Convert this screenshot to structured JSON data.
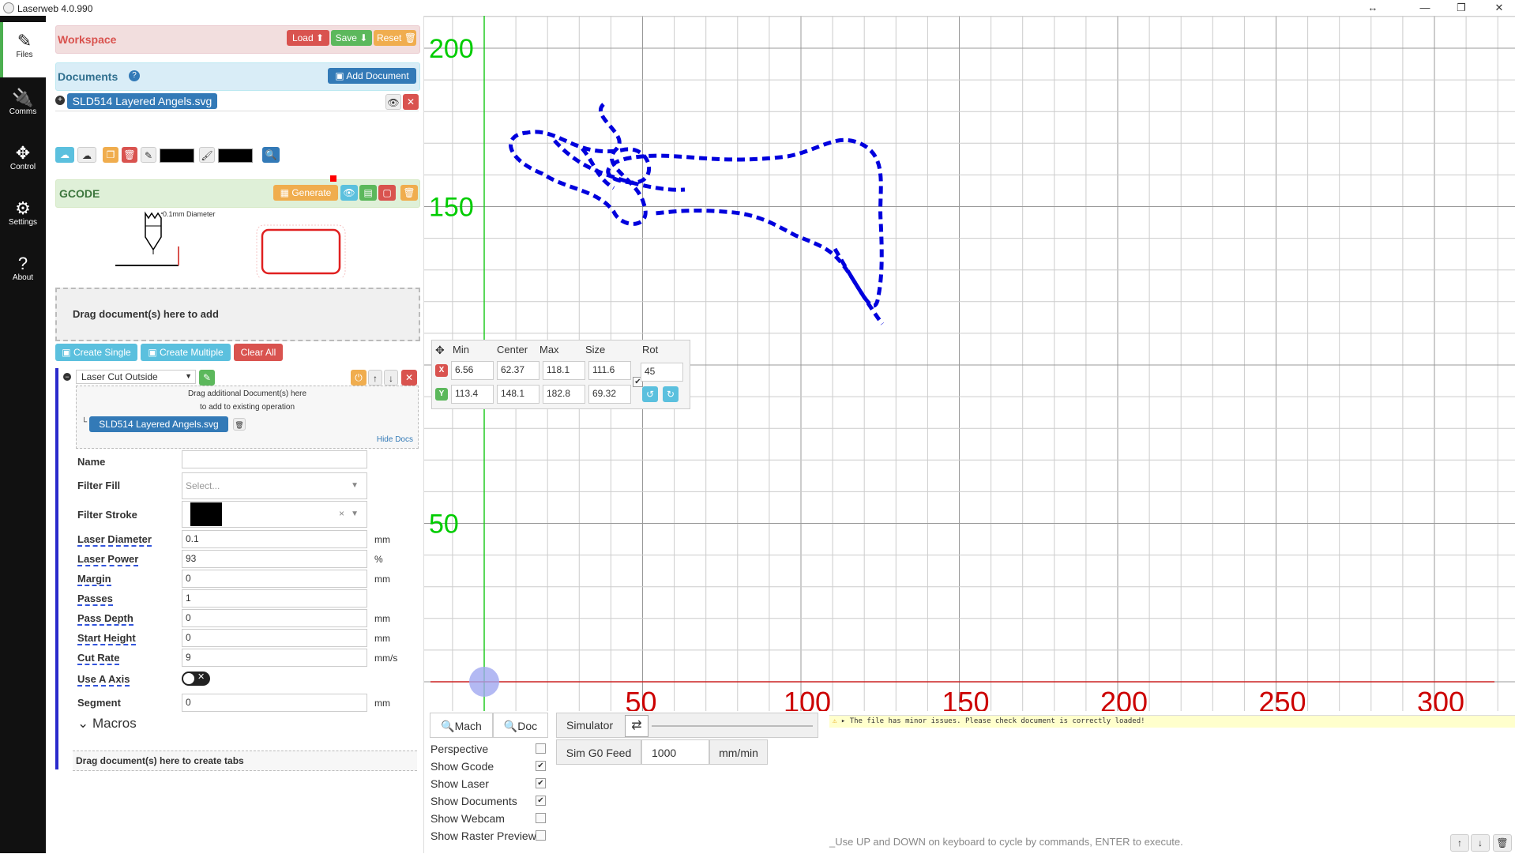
{
  "app": {
    "title": "Laserweb 4.0.990"
  },
  "sidebar": {
    "items": [
      {
        "label": "Files",
        "icon": "files-icon"
      },
      {
        "label": "Comms",
        "icon": "plug-icon"
      },
      {
        "label": "Control",
        "icon": "arrows-icon"
      },
      {
        "label": "Settings",
        "icon": "gears-icon"
      },
      {
        "label": "About",
        "icon": "question-icon"
      }
    ]
  },
  "workspace": {
    "title": "Workspace",
    "load": "Load",
    "save": "Save",
    "reset": "Reset"
  },
  "documents": {
    "title": "Documents",
    "add": "Add Document",
    "file": "SLD514 Layered Angels.svg"
  },
  "gcode": {
    "title": "GCODE",
    "generate": "Generate",
    "diameter_label": "0.1mm Diameter"
  },
  "drop": {
    "text": "Drag document(s) here to add",
    "create_single": "Create Single",
    "create_multiple": "Create Multiple",
    "clear_all": "Clear All"
  },
  "operation": {
    "type": "Laser Cut Outside",
    "drag_hint_1": "Drag additional Document(s) here",
    "drag_hint_2": "to add to existing operation",
    "doc": "SLD514 Layered Angels.svg",
    "hide_docs": "Hide Docs",
    "fields": {
      "name": {
        "label": "Name",
        "value": ""
      },
      "filter_fill": {
        "label": "Filter Fill",
        "placeholder": "Select..."
      },
      "filter_stroke": {
        "label": "Filter Stroke"
      },
      "laser_diameter": {
        "label": "Laser Diameter",
        "value": "0.1",
        "unit": "mm"
      },
      "laser_power": {
        "label": "Laser Power",
        "value": "93",
        "unit": "%"
      },
      "margin": {
        "label": "Margin",
        "value": "0",
        "unit": "mm"
      },
      "passes": {
        "label": "Passes",
        "value": "1"
      },
      "pass_depth": {
        "label": "Pass Depth",
        "value": "0",
        "unit": "mm"
      },
      "start_height": {
        "label": "Start Height",
        "value": "0",
        "unit": "mm"
      },
      "cut_rate": {
        "label": "Cut Rate",
        "value": "9",
        "unit": "mm/s"
      },
      "use_a_axis": {
        "label": "Use A Axis"
      },
      "segment": {
        "label": "Segment",
        "value": "0",
        "unit": "mm"
      }
    },
    "macros": "Macros",
    "tabs_hint": "Drag document(s) here to create tabs"
  },
  "transform": {
    "headers": [
      "Min",
      "Center",
      "Max",
      "Size",
      "Rot"
    ],
    "x": {
      "label": "X",
      "min": "6.56",
      "center": "62.37",
      "max": "118.1",
      "size": "111.6"
    },
    "y": {
      "label": "Y",
      "min": "113.4",
      "center": "148.1",
      "max": "182.8",
      "size": "69.32"
    },
    "rot": "45"
  },
  "axes": {
    "x_ticks": [
      "50",
      "100",
      "150",
      "200",
      "250",
      "300"
    ],
    "y_ticks": [
      "200",
      "150",
      "50"
    ],
    "x_color": "#cc0000",
    "y_color": "#00cc00"
  },
  "view": {
    "mach": "Mach",
    "doc": "Doc",
    "simulator": "Simulator",
    "sim_feed_label": "Sim G0 Feed",
    "sim_feed_value": "1000",
    "sim_feed_unit": "mm/min",
    "options": [
      {
        "label": "Perspective",
        "checked": false
      },
      {
        "label": "Show Gcode",
        "checked": true
      },
      {
        "label": "Show Laser",
        "checked": true
      },
      {
        "label": "Show Documents",
        "checked": true
      },
      {
        "label": "Show Webcam",
        "checked": false
      },
      {
        "label": "Show Raster Preview",
        "checked": false
      }
    ]
  },
  "console": {
    "warning": "The file has minor issues. Please check document is correctly loaded!",
    "placeholder": "_Use UP and DOWN on keyboard to cycle by commands, ENTER to execute."
  }
}
